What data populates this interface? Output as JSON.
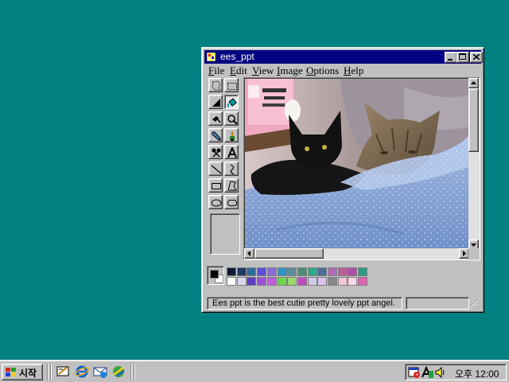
{
  "window": {
    "title": "ees_ppt",
    "menu": [
      "File",
      "Edit",
      "View",
      "Image",
      "Options",
      "Help"
    ],
    "menu_accel": [
      "F",
      "E",
      "V",
      "I",
      "O",
      "H"
    ],
    "status_text": "Ees ppt is the best cutie pretty lovely ppt angel."
  },
  "tools": [
    "free-form-select-icon",
    "select-icon",
    "eraser-icon",
    "fill-icon",
    "pick-color-icon",
    "magnifier-icon",
    "pencil-icon",
    "brush-icon",
    "airbrush-icon",
    "text-icon",
    "line-icon",
    "curve-icon",
    "rectangle-icon",
    "polygon-icon",
    "ellipse-icon",
    "rounded-rectangle-icon"
  ],
  "palette": {
    "foreground": "#000000",
    "background": "#ffffff",
    "row1": [
      "#101838",
      "#1c3c64",
      "#2c6c9c",
      "#5c4cd8",
      "#8c6cd8",
      "#2c98c8",
      "#5c8c9c",
      "#4c8c78",
      "#2cac8c",
      "#4c6c9c",
      "#b06cb8",
      "#c05c98",
      "#b04ca8",
      "#2c9c88"
    ],
    "row2": [
      "#ffffff",
      "#d8d8f0",
      "#5c3cc0",
      "#9c4cd8",
      "#c05ce0",
      "#6cd84c",
      "#9cd86c",
      "#c04cc0",
      "#cccce8",
      "#dcc0f0",
      "#888888",
      "#f0c8d8",
      "#f8d8e8",
      "#e060b0"
    ]
  },
  "taskbar": {
    "start_label": "시작",
    "quick_launch": [
      "show-desktop-icon",
      "internet-explorer-icon",
      "outlook-express-icon",
      "channels-icon"
    ],
    "tray_icons": [
      "task-scheduler-icon",
      "ime-icon",
      "volume-icon"
    ],
    "clock": "오후 12:00"
  }
}
